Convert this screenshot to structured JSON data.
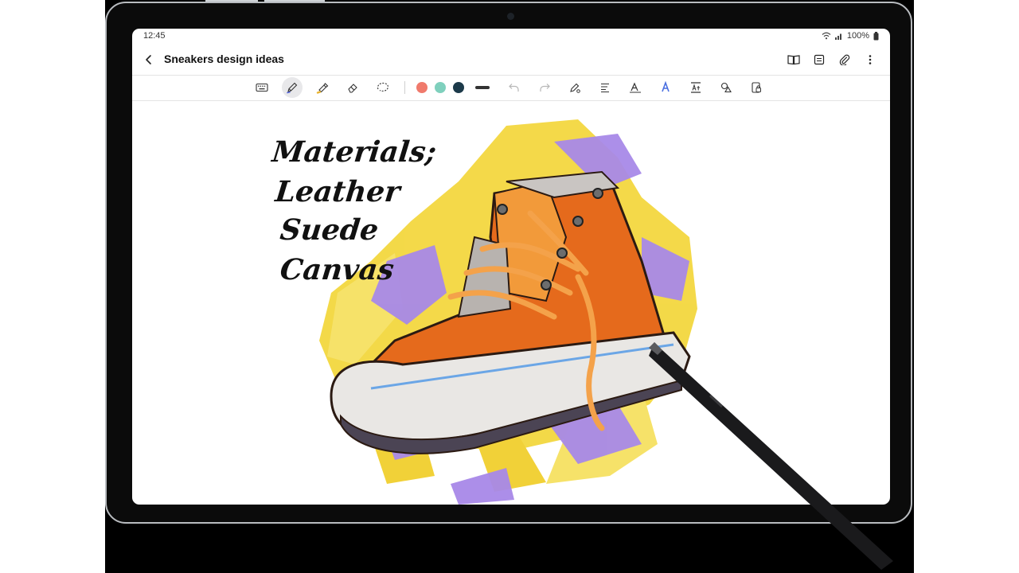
{
  "status": {
    "time": "12:45",
    "battery": "100%"
  },
  "app": {
    "title": "Sneakers design ideas",
    "back_icon": "back-arrow-icon",
    "actions": [
      "book-view-icon",
      "page-layout-icon",
      "attach-icon",
      "more-options-icon"
    ]
  },
  "toolbar": {
    "tools": [
      "keyboard-icon",
      "pen-icon",
      "highlighter-icon",
      "eraser-icon",
      "lasso-icon"
    ],
    "active_tool": "pen-icon",
    "colors": [
      "#f07a6c",
      "#7fd0bd",
      "#1c3a4a"
    ],
    "actions": [
      "undo-icon",
      "redo-icon",
      "pen-settings-icon",
      "text-format-icon",
      "convert-text-icon",
      "shape-icon",
      "scale-text-icon",
      "shapes-icon",
      "lock-icon"
    ]
  },
  "note": {
    "handwriting": [
      "Materials;",
      "Leather",
      "Suede",
      "Canvas"
    ]
  }
}
